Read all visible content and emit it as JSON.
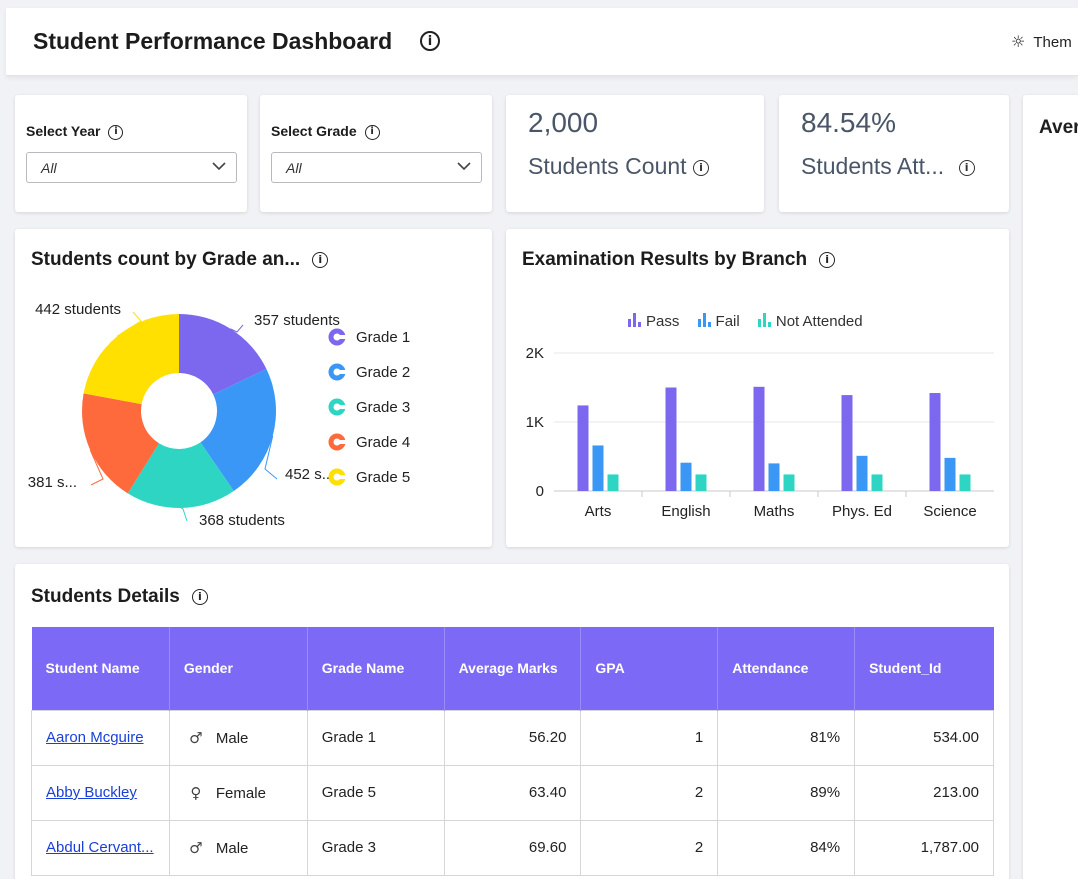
{
  "header": {
    "title": "Student Performance Dashboard",
    "theme_label": "Them"
  },
  "filters": {
    "year": {
      "label": "Select Year",
      "value": "All"
    },
    "grade": {
      "label": "Select Grade",
      "value": "All"
    }
  },
  "kpis": [
    {
      "value": "2,000",
      "label": "Students Count"
    },
    {
      "value": "84.54%",
      "label": "Students Att..."
    }
  ],
  "side_card": {
    "label": "Aver"
  },
  "donut": {
    "title": "Students count by Grade an...",
    "slice_labels": [
      "357 students",
      "452 s...",
      "368 students",
      "381 s...",
      "442 students"
    ],
    "legend": [
      "Grade 1",
      "Grade 2",
      "Grade 3",
      "Grade 4",
      "Grade 5"
    ],
    "colors": [
      "#7b68ee",
      "#3a97f6",
      "#2fd5c3",
      "#ff6a3d",
      "#ffe000"
    ]
  },
  "bar": {
    "title": "Examination Results by Branch",
    "legend": [
      "Pass",
      "Fail",
      "Not Attended"
    ],
    "colors": [
      "#7b68ee",
      "#3a97f6",
      "#2fd5c3"
    ],
    "y_ticks": [
      "2K",
      "1K",
      "0"
    ]
  },
  "chart_data": [
    {
      "type": "pie",
      "title": "Students count by Grade an...",
      "categories": [
        "Grade 1",
        "Grade 2",
        "Grade 3",
        "Grade 4",
        "Grade 5"
      ],
      "values": [
        357,
        452,
        368,
        381,
        442
      ]
    },
    {
      "type": "bar",
      "title": "Examination Results by Branch",
      "categories": [
        "Arts",
        "English",
        "Maths",
        "Phys. Ed",
        "Science"
      ],
      "series": [
        {
          "name": "Pass",
          "values": [
            1240,
            1500,
            1510,
            1390,
            1420
          ]
        },
        {
          "name": "Fail",
          "values": [
            660,
            410,
            400,
            510,
            480
          ]
        },
        {
          "name": "Not Attended",
          "values": [
            240,
            240,
            240,
            240,
            240
          ]
        }
      ],
      "ylim": [
        0,
        2000
      ]
    }
  ],
  "table": {
    "title": "Students Details",
    "columns": [
      "Student Name",
      "Gender",
      "Grade Name",
      "Average Marks",
      "GPA",
      "Attendance",
      "Student_Id"
    ],
    "rows": [
      {
        "name": "Aaron Mcguire",
        "gender": "Male",
        "gender_icon": "male-icon",
        "grade": "Grade 1",
        "marks": "56.20",
        "gpa": "1",
        "attendance": "81%",
        "id": "534.00"
      },
      {
        "name": "Abby Buckley",
        "gender": "Female",
        "gender_icon": "female-icon",
        "grade": "Grade 5",
        "marks": "63.40",
        "gpa": "2",
        "attendance": "89%",
        "id": "213.00"
      },
      {
        "name": "Abdul Cervant...",
        "gender": "Male",
        "gender_icon": "male-icon",
        "grade": "Grade 3",
        "marks": "69.60",
        "gpa": "2",
        "attendance": "84%",
        "id": "1,787.00"
      }
    ]
  }
}
